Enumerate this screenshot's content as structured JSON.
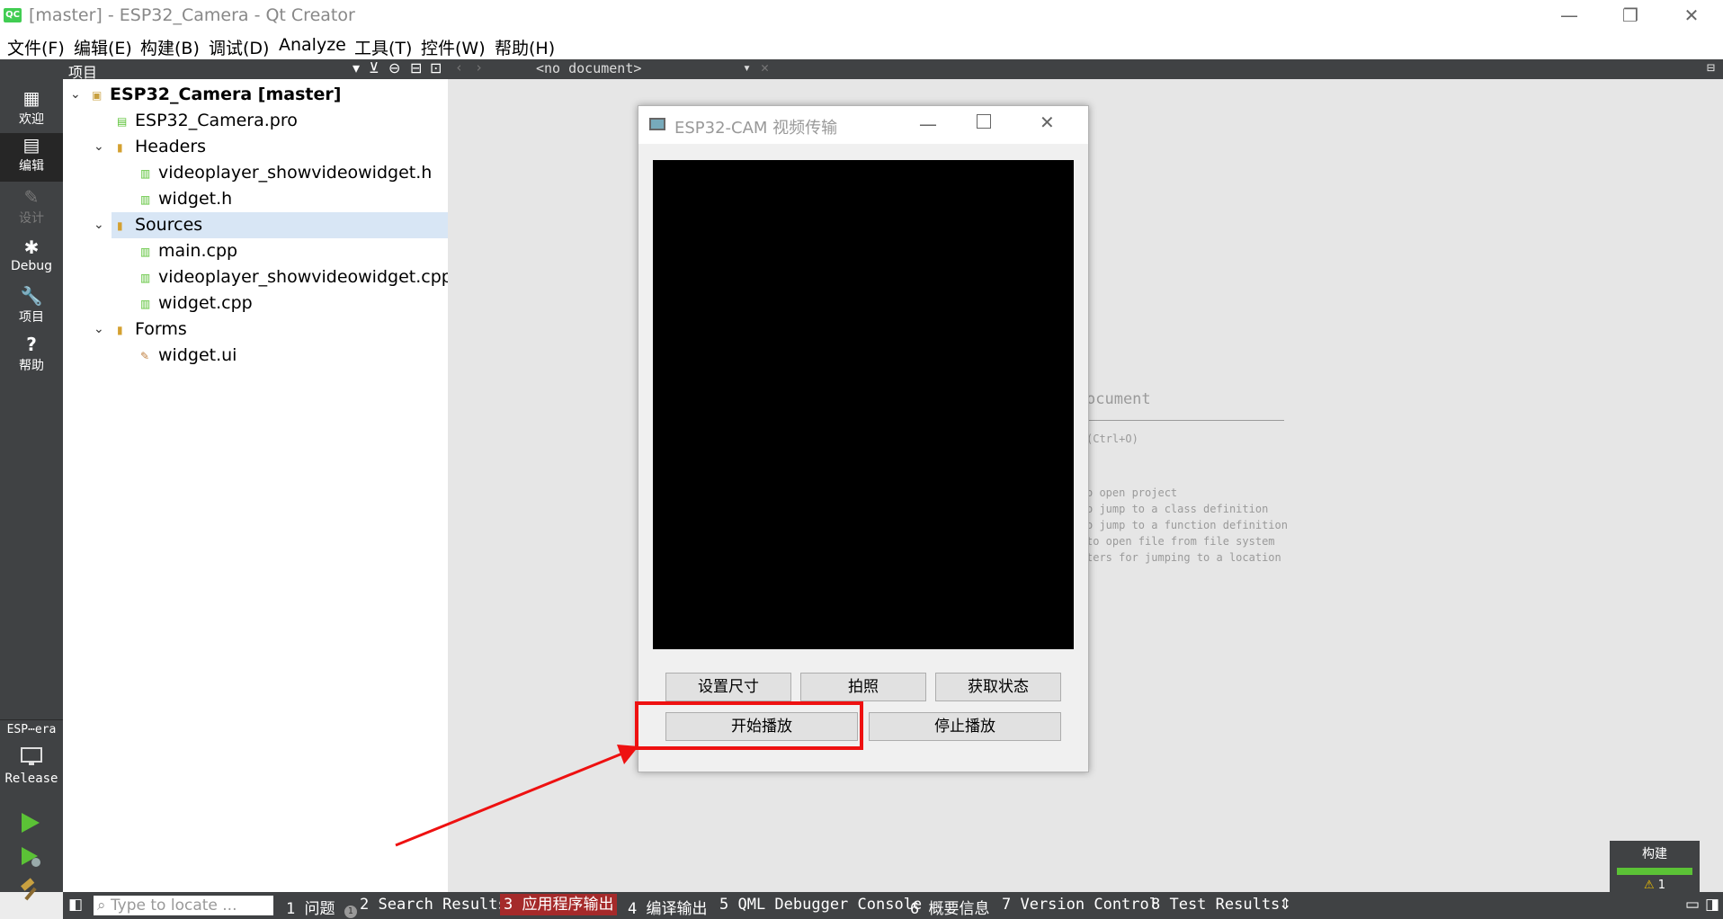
{
  "window": {
    "logo": "QC",
    "title": "[master] - ESP32_Camera - Qt Creator",
    "min": "—",
    "max": "❐",
    "close": "✕"
  },
  "menu": [
    "文件(F)",
    "编辑(E)",
    "构建(B)",
    "调试(D)",
    "Analyze",
    "工具(T)",
    "控件(W)",
    "帮助(H)"
  ],
  "modes": [
    {
      "label": "欢迎",
      "icon": "▦"
    },
    {
      "label": "编辑",
      "icon": "▤"
    },
    {
      "label": "设计",
      "icon": "✎"
    },
    {
      "label": "Debug",
      "icon": "✱"
    },
    {
      "label": "项目",
      "icon": "🔧"
    },
    {
      "label": "帮助",
      "icon": "?"
    }
  ],
  "kit": {
    "project": "ESP⋯era",
    "config": "Release"
  },
  "project_pane": {
    "title": "项目"
  },
  "tree": [
    {
      "label": "ESP32_Camera [master]",
      "arrow": "⌄"
    },
    {
      "label": "ESP32_Camera.pro"
    },
    {
      "label": "Headers",
      "arrow": "⌄"
    },
    {
      "label": "videoplayer_showvideowidget.h"
    },
    {
      "label": "widget.h"
    },
    {
      "label": "Sources",
      "arrow": "⌄"
    },
    {
      "label": "main.cpp"
    },
    {
      "label": "videoplayer_showvideowidget.cpp"
    },
    {
      "label": "widget.cpp"
    },
    {
      "label": "Forms",
      "arrow": "⌄"
    },
    {
      "label": "widget.ui"
    }
  ],
  "editor": {
    "doc_selector": "<no document>",
    "heading": "ocument",
    "open_hint": "(Ctrl+O)",
    "hints": [
      "o open project",
      "o jump to a class definition",
      "o jump to a function definition",
      "to open file from file system",
      "ters for jumping to a location"
    ]
  },
  "app_window": {
    "title": "ESP32-CAM 视频传输",
    "buttons": {
      "set_size": "设置尺寸",
      "photo": "拍照",
      "get_status": "获取状态",
      "start_play": "开始播放",
      "stop_play": "停止播放"
    }
  },
  "status": {
    "locate_placeholder": "Type to locate ...",
    "tabs": [
      "1 问题",
      "2 Search Results",
      "3 应用程序输出",
      "4 编译输出",
      "5 QML Debugger Console",
      "6 概要信息",
      "7 Version Control",
      "8 Test Results"
    ],
    "issues_badge": "1"
  },
  "build": {
    "label": "构建",
    "warnings": "1"
  },
  "colors": {
    "highlight": "#ee1111",
    "active_tab": "#a52a2a",
    "run": "#5bc236"
  }
}
